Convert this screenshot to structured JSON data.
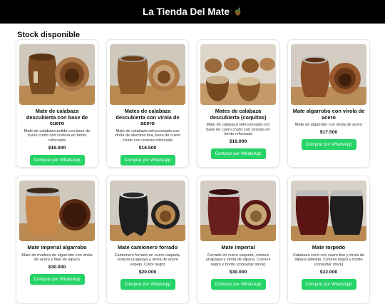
{
  "header": {
    "title": "La Tienda Del Mate",
    "icon": "mate-icon"
  },
  "section_title": "Stock disponible",
  "products": [
    {
      "name": "Mate de calabaza descubierta con base de cuero",
      "description": "Mate de calabaza pulida con base de cuero crudo con costura en tiento reforzada",
      "price": "$16.000",
      "button": "Comprar por WhatsApp"
    },
    {
      "name": "Mates de calabaza descubierta con virola de acero",
      "description": "Mate de calabaza seleccionada con virola de aluminio lisa, base de cuero crudo con costura reforzada",
      "price": "$16.500",
      "button": "Comprar por WhatsApp"
    },
    {
      "name": "Mates de calabaza descubierta (coquitos)",
      "description": "Mate de calabaza seleccionada con base de cuero crudo con costura en tiento reforzada",
      "price": "$16.000",
      "button": "Comprar por WhatsApp"
    },
    {
      "name": "Mate algarrobo con virola de acero",
      "description": "Mate de algarrobo con virola de acero",
      "price": "$17.500",
      "button": "Comprar por WhatsApp"
    },
    {
      "name": "Mate imperial algarrobo",
      "description": "Mate de madera de algarrobo con virola de acero y fleje de alpaca",
      "price": "$30.000",
      "button": "Comprar por WhatsApp"
    },
    {
      "name": "Mate camionero forrado",
      "description": "Camionero forrado en cuero vaqueta, costura uruguaya y virola de acero espejo. Color negro",
      "price": "$20.000",
      "button": "Comprar por WhatsApp"
    },
    {
      "name": "Mate imperial",
      "description": "Forrado en cuero vaqueta, costura uruguaya y virola de alpaca. Colores negro y bordo (consultar stock)",
      "price": "$30.000",
      "button": "Comprar por WhatsApp"
    },
    {
      "name": "Mate torpedo",
      "description": "Calabaza coco con cuero liso y virola de alpaca labrada. Colores negro y bordo (consultar stock)",
      "price": "$32.000",
      "button": "Comprar por WhatsApp"
    }
  ],
  "colors": {
    "header_bg": "#000000",
    "button_bg": "#25d366",
    "button_text": "#ffffff"
  }
}
